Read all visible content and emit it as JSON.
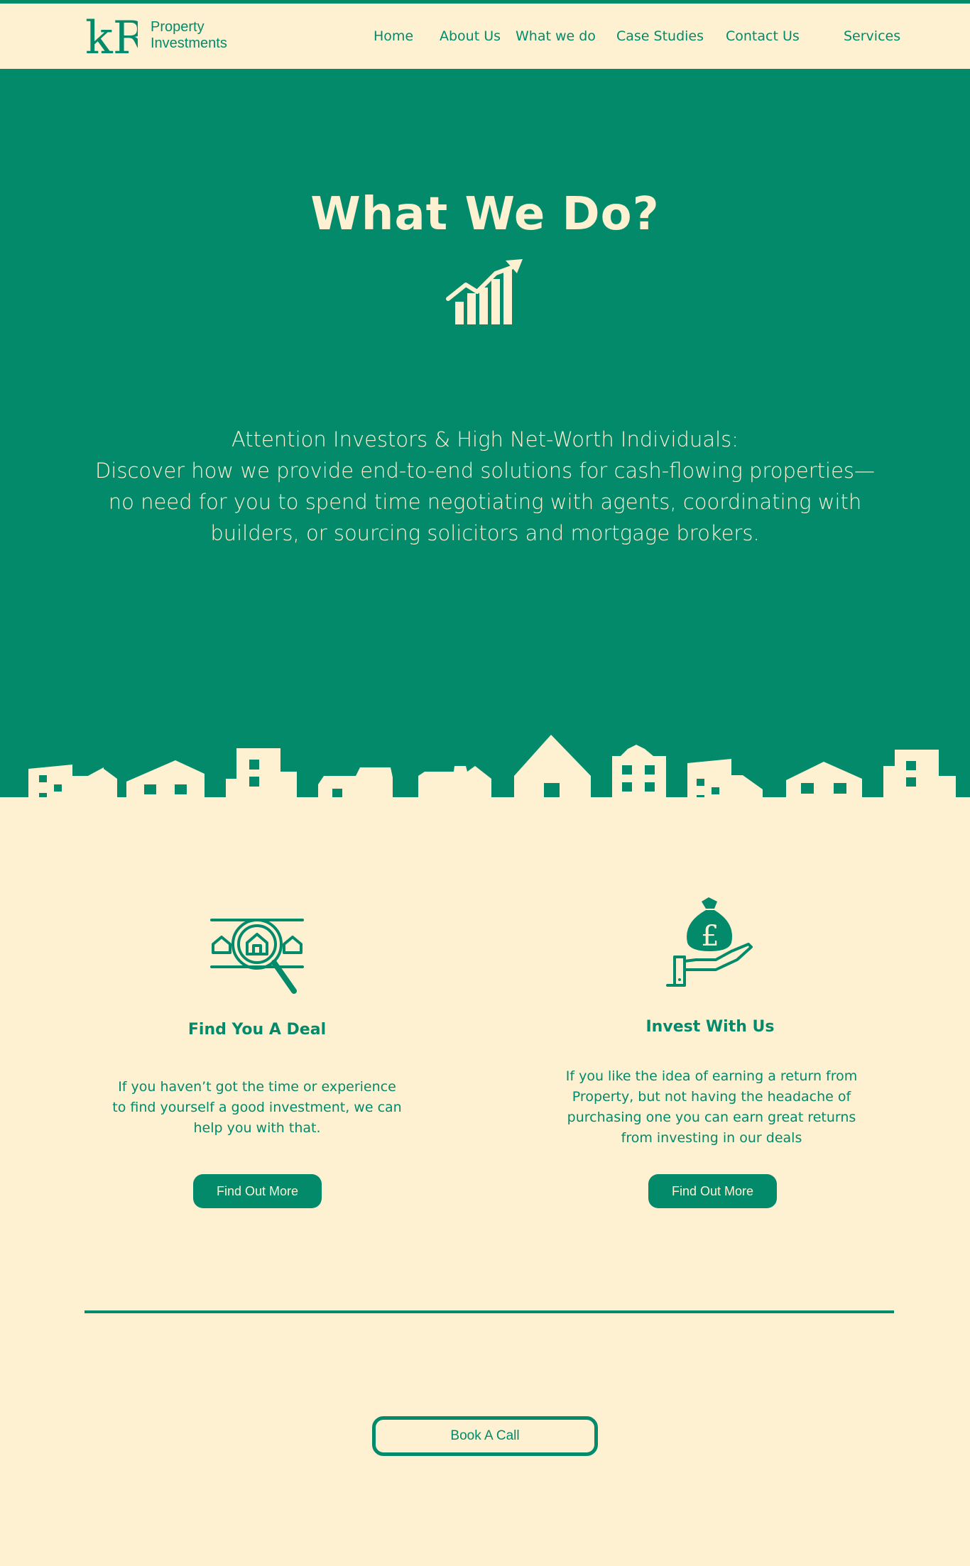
{
  "colors": {
    "primary": "#028a6b",
    "cream": "#fdf1d2"
  },
  "header": {
    "logo_mark": "kR",
    "logo_line1": "Property",
    "logo_line2": "Investments",
    "nav": [
      "Home",
      "About Us",
      "What we do",
      "Case Studies",
      "Contact Us",
      "Services"
    ]
  },
  "hero": {
    "title": "What We Do?",
    "icon": "growth-chart-icon",
    "lines": [
      "Attention Investors & High Net-Worth Individuals:",
      "Discover how we provide end-to-end solutions for cash-flowing properties—",
      "no need for you to spend time negotiating with agents, coordinating with",
      "builders, or sourcing solicitors and mortgage brokers."
    ],
    "decoration": "city-skyline"
  },
  "features": [
    {
      "icon": "house-search-icon",
      "title": "Find You A Deal",
      "lines": [
        "If you haven’t got the time or experience",
        "to find yourself a good investment, we can",
        "help you with that."
      ],
      "button": "Find Out More"
    },
    {
      "icon": "money-bag-hand-icon",
      "title": "Invest With Us",
      "lines": [
        "If you like the idea of earning a return from",
        "Property, but not having the headache of",
        "purchasing one you can earn great returns",
        "from investing in our deals"
      ],
      "button": "Find Out More"
    }
  ],
  "cta": {
    "label": "Book A Call"
  }
}
